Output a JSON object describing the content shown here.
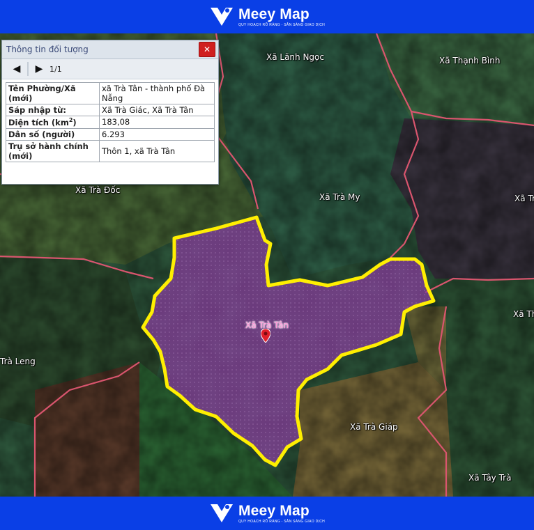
{
  "brand": {
    "name": "Meey Map",
    "tagline": "QUY HOẠCH RÕ RÀNG - SẴN SÀNG GIAO DỊCH"
  },
  "colors": {
    "brand_blue": "#0a3fe6",
    "highlight_outline": "#ffef00",
    "highlight_fill": "#8a3fa0",
    "boundary": "#d9556e"
  },
  "panel": {
    "title": "Thông tin đối tượng",
    "close_icon": "close-icon",
    "pager": {
      "prev_icon": "triangle-left-icon",
      "next_icon": "triangle-right-icon",
      "count": "1/1"
    },
    "rows": [
      {
        "key": "Tên Phường/Xã (mới)",
        "value": "xã Trà Tân - thành phố Đà Nẵng"
      },
      {
        "key": "Sáp nhập từ:",
        "value": "Xã Trà Giác, Xã Trà Tân"
      },
      {
        "key_main": "Diện tích (km",
        "key_sup": "2",
        "key_end": ")",
        "value": "183,08"
      },
      {
        "key": "Dân số (người)",
        "value": "6.293"
      },
      {
        "key": "Trụ sở hành chính (mới)",
        "value": "Thôn 1, xã Trà Tân"
      }
    ]
  },
  "map": {
    "selected_label": "Xã Trà Tân",
    "marker_icon": "map-pin-icon",
    "places": [
      "Xã Lãnh Ngọc",
      "Xã Thạnh Bình",
      "Xã Trà Đốc",
      "Xã Trà My",
      "Xã Trà",
      "Xã Th",
      "Trà Leng",
      "Xã Trà Giáp",
      "Xã Tây Trà"
    ]
  }
}
